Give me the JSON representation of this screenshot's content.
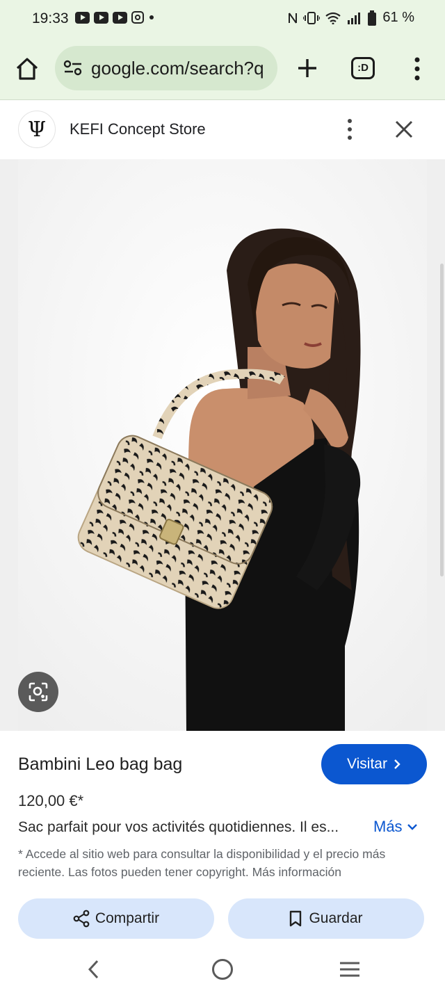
{
  "status_bar": {
    "time": "19:33",
    "battery": "61 %",
    "icons": [
      "youtube-icon",
      "youtube-icon",
      "youtube-icon",
      "instagram-icon",
      "notification-dot-icon",
      "nfc-icon",
      "vibrate-icon",
      "wifi-icon",
      "signal-icon",
      "battery-icon"
    ]
  },
  "browser": {
    "url": "google.com/search?q",
    "tabs_label": ":D",
    "theme_color": "#eaf5e4"
  },
  "panel": {
    "store_name": "KEFI Concept Store",
    "logo_glyph": "Ψ"
  },
  "product": {
    "title": "Bambini Leo bag bag",
    "visit_label": "Visitar",
    "price": "120,00 €*",
    "description": "Sac parfait pour vos activités quotidiennes. Il es...",
    "more_label": "Más",
    "disclaimer": "* Accede al sitio web para consultar la disponibilidad y el precio más reciente. Las fotos pueden tener copyright. Más información",
    "share_label": "Compartir",
    "save_label": "Guardar",
    "accent_color": "#0b57d0"
  }
}
